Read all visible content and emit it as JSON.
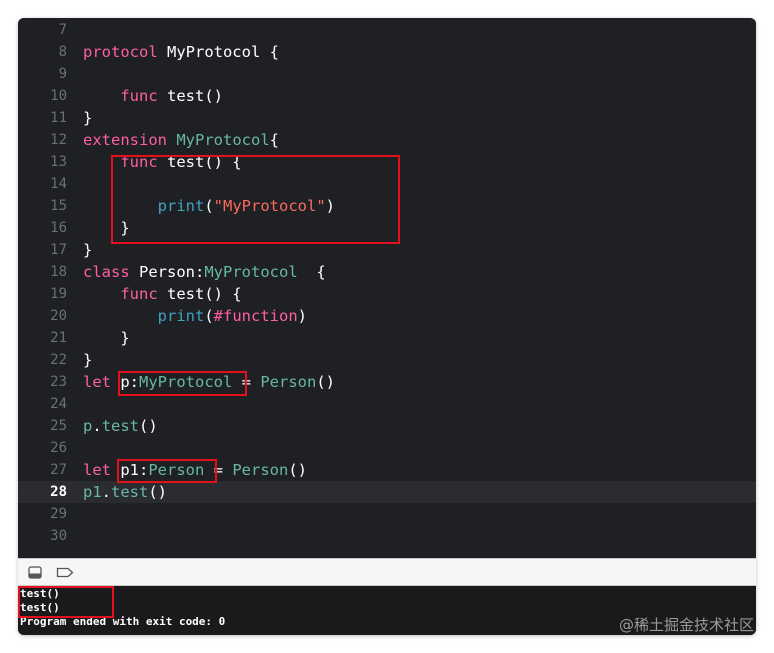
{
  "editor": {
    "current_line": "28",
    "lines": [
      {
        "num": "7",
        "tokens": []
      },
      {
        "num": "8",
        "tokens": [
          {
            "t": "protocol",
            "c": "kw"
          },
          {
            "t": " MyProtocol {",
            "c": "pl"
          }
        ]
      },
      {
        "num": "9",
        "tokens": []
      },
      {
        "num": "10",
        "tokens": [
          {
            "t": "    ",
            "c": "pl"
          },
          {
            "t": "func",
            "c": "kw"
          },
          {
            "t": " test()",
            "c": "pl"
          }
        ]
      },
      {
        "num": "11",
        "tokens": [
          {
            "t": "}",
            "c": "pl"
          }
        ]
      },
      {
        "num": "12",
        "tokens": [
          {
            "t": "extension",
            "c": "kw"
          },
          {
            "t": " ",
            "c": "pl"
          },
          {
            "t": "MyProtocol",
            "c": "tyg"
          },
          {
            "t": "{",
            "c": "pl"
          }
        ]
      },
      {
        "num": "13",
        "tokens": [
          {
            "t": "    ",
            "c": "pl"
          },
          {
            "t": "func",
            "c": "kw"
          },
          {
            "t": " test() {",
            "c": "pl"
          }
        ]
      },
      {
        "num": "14",
        "tokens": []
      },
      {
        "num": "15",
        "tokens": [
          {
            "t": "        ",
            "c": "pl"
          },
          {
            "t": "print",
            "c": "fn"
          },
          {
            "t": "(",
            "c": "pl"
          },
          {
            "t": "\"MyProtocol\"",
            "c": "str"
          },
          {
            "t": ")",
            "c": "pl"
          }
        ]
      },
      {
        "num": "16",
        "tokens": [
          {
            "t": "    }",
            "c": "pl"
          }
        ]
      },
      {
        "num": "17",
        "tokens": [
          {
            "t": "}",
            "c": "pl"
          }
        ]
      },
      {
        "num": "18",
        "tokens": [
          {
            "t": "class",
            "c": "kw"
          },
          {
            "t": " Person:",
            "c": "pl"
          },
          {
            "t": "MyProtocol",
            "c": "tyg"
          },
          {
            "t": "  {",
            "c": "pl"
          }
        ]
      },
      {
        "num": "19",
        "tokens": [
          {
            "t": "    ",
            "c": "pl"
          },
          {
            "t": "func",
            "c": "kw"
          },
          {
            "t": " test() {",
            "c": "pl"
          }
        ]
      },
      {
        "num": "20",
        "tokens": [
          {
            "t": "        ",
            "c": "pl"
          },
          {
            "t": "print",
            "c": "fn"
          },
          {
            "t": "(",
            "c": "pl"
          },
          {
            "t": "#function",
            "c": "kw"
          },
          {
            "t": ")",
            "c": "pl"
          }
        ]
      },
      {
        "num": "21",
        "tokens": [
          {
            "t": "    }",
            "c": "pl"
          }
        ]
      },
      {
        "num": "22",
        "tokens": [
          {
            "t": "}",
            "c": "pl"
          }
        ]
      },
      {
        "num": "23",
        "tokens": [
          {
            "t": "let",
            "c": "kw"
          },
          {
            "t": " p:",
            "c": "pl"
          },
          {
            "t": "MyProtocol",
            "c": "tyg"
          },
          {
            "t": " = ",
            "c": "pl"
          },
          {
            "t": "Person",
            "c": "tyg"
          },
          {
            "t": "()",
            "c": "pl"
          }
        ]
      },
      {
        "num": "24",
        "tokens": []
      },
      {
        "num": "25",
        "tokens": [
          {
            "t": "p",
            "c": "tyg"
          },
          {
            "t": ".",
            "c": "pl"
          },
          {
            "t": "test",
            "c": "tyg"
          },
          {
            "t": "()",
            "c": "pl"
          }
        ]
      },
      {
        "num": "26",
        "tokens": []
      },
      {
        "num": "27",
        "tokens": [
          {
            "t": "let",
            "c": "kw"
          },
          {
            "t": " p1:",
            "c": "pl"
          },
          {
            "t": "Person",
            "c": "tyg"
          },
          {
            "t": " = ",
            "c": "pl"
          },
          {
            "t": "Person",
            "c": "tyg"
          },
          {
            "t": "()",
            "c": "pl"
          }
        ]
      },
      {
        "num": "28",
        "tokens": [
          {
            "t": "p1",
            "c": "tyg"
          },
          {
            "t": ".",
            "c": "pl"
          },
          {
            "t": "test",
            "c": "tyg"
          },
          {
            "t": "()",
            "c": "pl"
          }
        ]
      },
      {
        "num": "29",
        "tokens": []
      },
      {
        "num": "30",
        "tokens": []
      }
    ]
  },
  "debug_bar": {
    "icons": [
      "hide-debug-area-icon",
      "breakpoint-toggle-icon"
    ]
  },
  "console": {
    "lines": [
      "test()",
      "test()",
      "Program ended with exit code: 0"
    ]
  },
  "watermark": "@稀土掘金技术社区",
  "colors": {
    "keyword": "#fc5fa3",
    "type": "#67b7a4",
    "function": "#41a1c0",
    "string": "#fc6a5d",
    "annotation_box": "#e3111c"
  }
}
